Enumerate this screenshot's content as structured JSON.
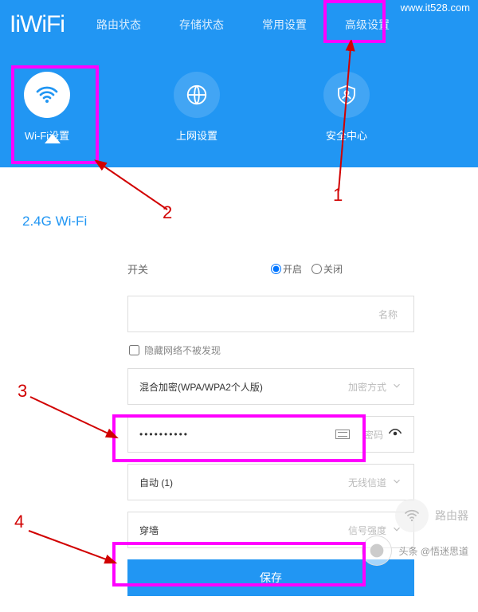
{
  "logo": "IiWiFi",
  "watermark_url": "www.it528.com",
  "tabs": [
    "路由状态",
    "存储状态",
    "常用设置",
    "高级设置"
  ],
  "active_tab_index": 2,
  "categories": [
    {
      "label": "Wi-Fi设置",
      "icon": "wifi"
    },
    {
      "label": "上网设置",
      "icon": "globe"
    },
    {
      "label": "安全中心",
      "icon": "shield"
    }
  ],
  "active_category_index": 0,
  "section_title": "2.4G Wi-Fi",
  "switch": {
    "label": "开关",
    "options": [
      "开启",
      "关闭"
    ],
    "selected": 0
  },
  "name_field": {
    "suffix": "名称",
    "value": ""
  },
  "hide_checkbox": {
    "label": "隐藏网络不被发现",
    "checked": false
  },
  "encryption_field": {
    "value": "混合加密(WPA/WPA2个人版)",
    "suffix": "加密方式"
  },
  "password_field": {
    "value": "••••••••••",
    "suffix": "密码"
  },
  "channel_field": {
    "value": "自动 (1)",
    "suffix": "无线信道"
  },
  "signal_field": {
    "value": "穿墙",
    "suffix": "信号强度"
  },
  "save_button": "保存",
  "annotations": {
    "n1": "1",
    "n2": "2",
    "n3": "3",
    "n4": "4"
  },
  "footer_wm_top": "路由器",
  "footer_wm_bottom": "头条 @悟迷思道"
}
